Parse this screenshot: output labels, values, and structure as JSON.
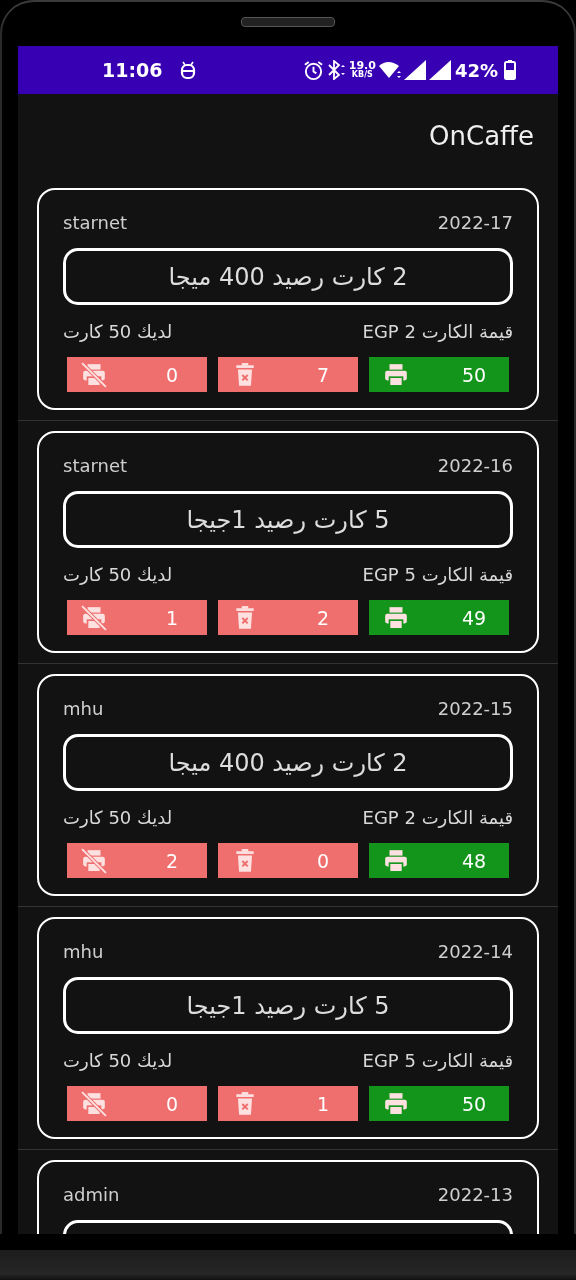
{
  "status_bar": {
    "time": "11:06",
    "speed_value": "19.0",
    "speed_unit": "KB/S",
    "battery": "42%"
  },
  "app_bar": {
    "title": "OnCaffe"
  },
  "cards": [
    {
      "user": "starnet",
      "date": "2022-17",
      "title": "2 كارت رصيد 400 ميجا",
      "price": "قيمة الكارت 2 EGP",
      "stock": "لديك 50 كارت",
      "counters": [
        {
          "kind": "printed",
          "value": "50"
        },
        {
          "kind": "deleted",
          "value": "7"
        },
        {
          "kind": "unprinted",
          "value": "0"
        }
      ]
    },
    {
      "user": "starnet",
      "date": "2022-16",
      "title": "5 كارت رصيد 1جيجا",
      "price": "قيمة الكارت 5 EGP",
      "stock": "لديك 50 كارت",
      "counters": [
        {
          "kind": "printed",
          "value": "49"
        },
        {
          "kind": "deleted",
          "value": "2"
        },
        {
          "kind": "unprinted",
          "value": "1"
        }
      ]
    },
    {
      "user": "mhu",
      "date": "2022-15",
      "title": "2 كارت رصيد 400 ميجا",
      "price": "قيمة الكارت 2 EGP",
      "stock": "لديك 50 كارت",
      "counters": [
        {
          "kind": "printed",
          "value": "48"
        },
        {
          "kind": "deleted",
          "value": "0"
        },
        {
          "kind": "unprinted",
          "value": "2"
        }
      ]
    },
    {
      "user": "mhu",
      "date": "2022-14",
      "title": "5 كارت رصيد 1جيجا",
      "price": "قيمة الكارت 5 EGP",
      "stock": "لديك 50 كارت",
      "counters": [
        {
          "kind": "printed",
          "value": "50"
        },
        {
          "kind": "deleted",
          "value": "1"
        },
        {
          "kind": "unprinted",
          "value": "0"
        }
      ]
    },
    {
      "user": "admin",
      "date": "2022-13"
    }
  ]
}
